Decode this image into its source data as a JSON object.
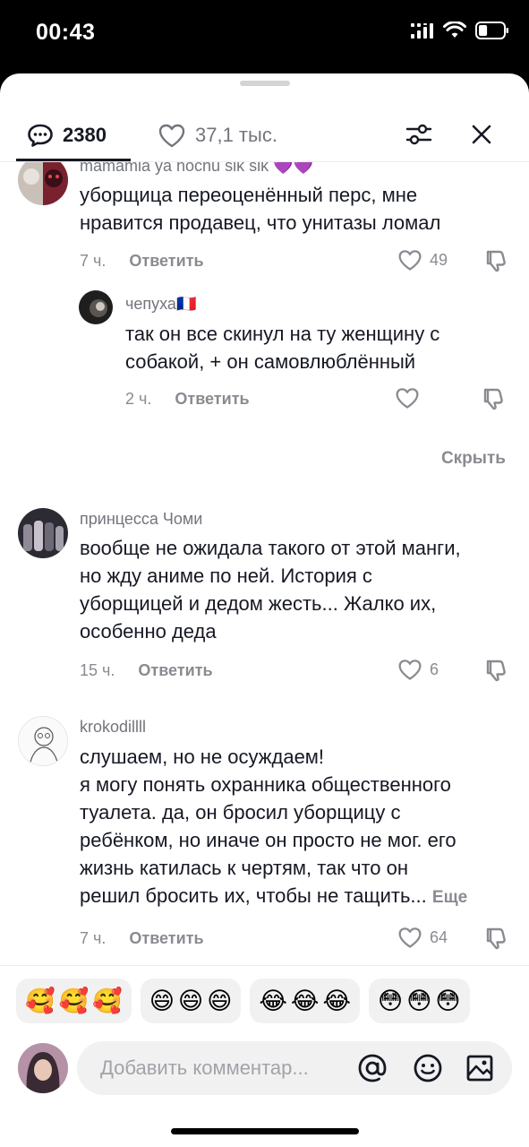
{
  "status_bar": {
    "time": "00:43",
    "battery_percent": 35
  },
  "header": {
    "comments_count": "2380",
    "likes_count": "37,1 тыс.",
    "icons": [
      "comment-bubble-icon",
      "heart-icon",
      "filter-sliders-icon",
      "close-icon"
    ]
  },
  "comments": [
    {
      "username": "mamamia ya hochu sik sik 💜💜",
      "text_lines": [
        "уборщица переоценённый перс, мне",
        "нравится продавец, что унитазы ломал"
      ],
      "time": "7 ч.",
      "reply_label": "Ответить",
      "likes": "49"
    },
    {
      "username": "чепуха🇫🇷",
      "text_lines": [
        "так он все скинул на ту женщину с",
        "собакой, + он самовлюблённый"
      ],
      "time": "2 ч.",
      "reply_label": "Ответить",
      "likes": ""
    },
    {
      "username": "принцесса Чоми",
      "text_lines": [
        "вообще не ожидала такого от этой манги,",
        "но жду аниме по ней. История с",
        "уборщицей и дедом жесть... Жалко их,",
        "особенно деда"
      ],
      "time": "15 ч.",
      "reply_label": "Ответить",
      "likes": "6"
    },
    {
      "username": "krokodillll",
      "text_lines": [
        "слушаем, но не осуждаем!",
        "я могу понять охранника общественного",
        "туалета. да, он бросил уборщицу с",
        "ребёнком, но иначе он просто не мог. его",
        "жизнь катилась к чертям, так что он",
        "решил бросить их, чтобы не тащить..."
      ],
      "more_label": "Еще",
      "time": "7 ч.",
      "reply_label": "Ответить",
      "likes": "64"
    }
  ],
  "hide_replies_label": "Скрыть",
  "emoji_groups": [
    [
      "🥰",
      "🥰",
      "🥰"
    ],
    [
      "😄",
      "😄",
      "😄"
    ],
    [
      "😂",
      "😂",
      "😂"
    ],
    [
      "😳",
      "😳",
      "😳"
    ]
  ],
  "input": {
    "placeholder": "Добавить комментар...",
    "icons": [
      "mention-icon",
      "emoji-icon",
      "image-icon"
    ]
  },
  "colors": {
    "text": "#161823",
    "secondary": "#8a8b91",
    "chip_bg": "#f1f1f2"
  }
}
